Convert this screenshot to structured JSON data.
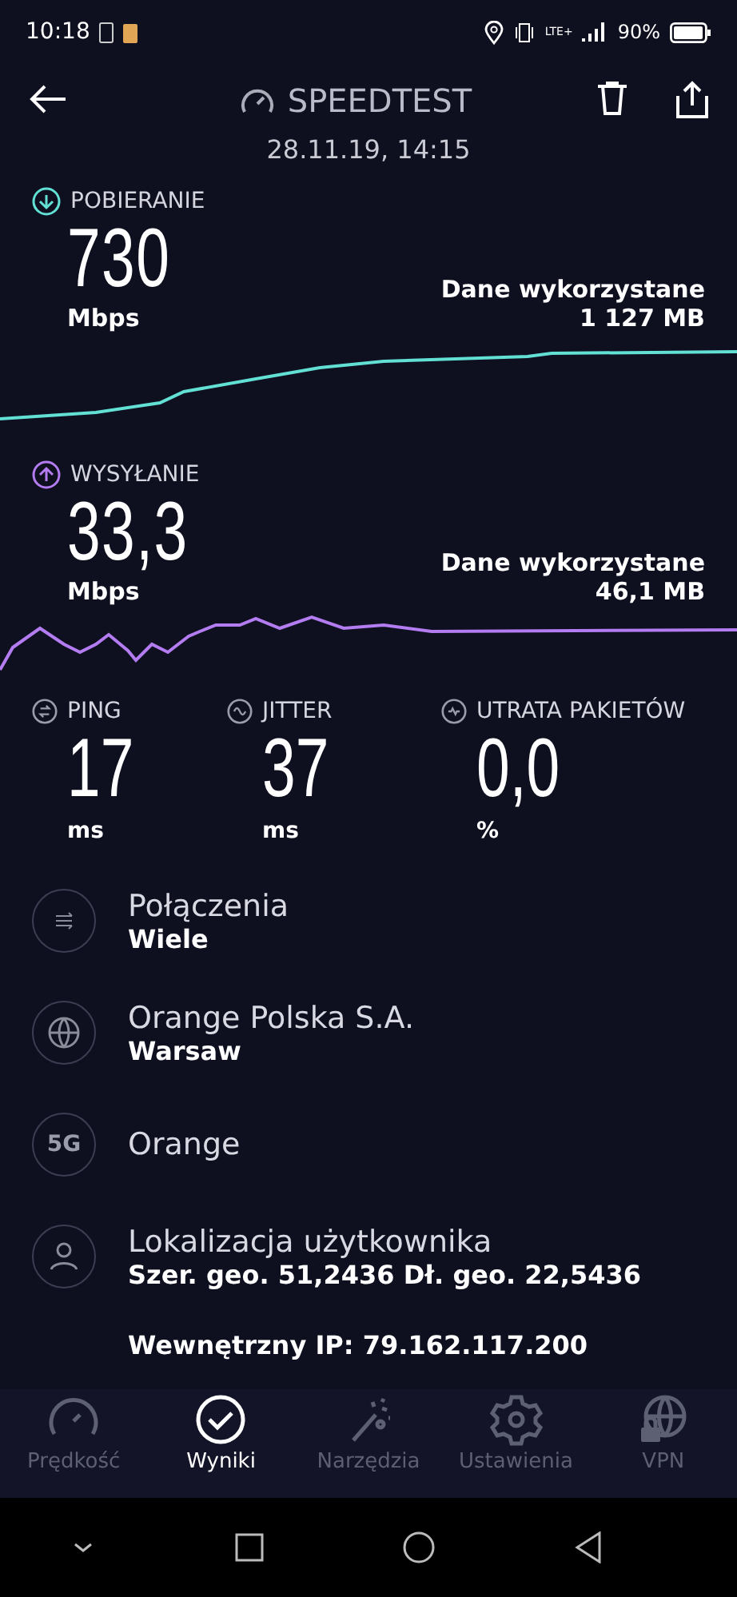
{
  "status_bar": {
    "time": "10:18",
    "network": "LTE+",
    "battery": "90%"
  },
  "header": {
    "title": "SPEEDTEST",
    "date": "28.11.19, 14:15"
  },
  "speeds": [
    {
      "kind": "download",
      "label": "POBIERANIE",
      "value": "730",
      "unit": "Mbps",
      "data_label": "Dane wykorzystane",
      "data_value": "1 127 MB"
    },
    {
      "kind": "upload",
      "label": "WYSYŁANIE",
      "value": "33,3",
      "unit": "Mbps",
      "data_label": "Dane wykorzystane",
      "data_value": "46,1 MB"
    }
  ],
  "metrics": [
    {
      "kind": "ping",
      "label": "PING",
      "value": "17",
      "unit": "ms"
    },
    {
      "kind": "jitter",
      "label": "JITTER",
      "value": "37",
      "unit": "ms"
    },
    {
      "kind": "loss",
      "label": "UTRATA PAKIETÓW",
      "value": "0,0",
      "unit": "%"
    }
  ],
  "details": [
    {
      "kind": "connections",
      "title": "Połączenia",
      "value": "Wiele"
    },
    {
      "kind": "server",
      "title": "Orange Polska S.A.",
      "value": "Warsaw"
    },
    {
      "kind": "network",
      "title": "Orange",
      "badge": "5G"
    },
    {
      "kind": "location",
      "title": "Lokalizacja użytkownika",
      "value": "Szer. geo. 51,2436 Dł. geo. 22,5436"
    },
    {
      "kind": "ip",
      "value": "Wewnętrzny IP: 79.162.117.200"
    }
  ],
  "tabs": [
    {
      "label": "Prędkość",
      "selected": false
    },
    {
      "label": "Wyniki",
      "selected": true
    },
    {
      "label": "Narzędzia",
      "selected": false
    },
    {
      "label": "Ustawienia",
      "selected": false
    },
    {
      "label": "VPN",
      "selected": false
    }
  ]
}
